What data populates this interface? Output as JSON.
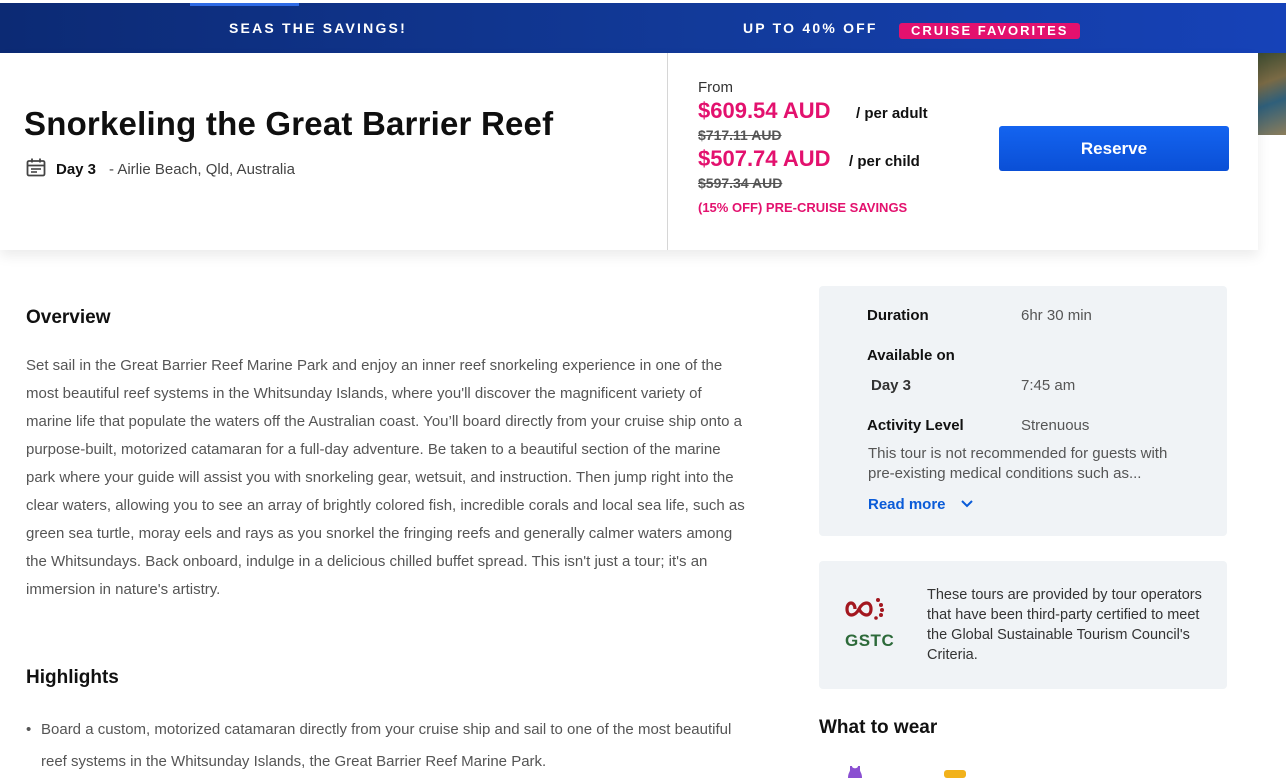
{
  "banner": {
    "left_text": "SEAS THE SAVINGS!",
    "right_text": "UP TO 40% OFF",
    "pill_text": "CRUISE FAVORITES",
    "colors": {
      "banner": "#123a9a",
      "pill": "#e3116e"
    }
  },
  "tour": {
    "title": "Snorkeling the Great Barrier Reef",
    "day": "Day 3",
    "location": "- Airlie Beach, Qld, Australia"
  },
  "pricing": {
    "from_label": "From",
    "adult_price": "$609.54 AUD",
    "adult_unit": "/ per adult",
    "adult_original": "$717.11 AUD",
    "child_price": "$507.74 AUD",
    "child_unit": "/ per child",
    "child_original": "$597.34 AUD",
    "savings_text": "(15% OFF) PRE-CRUISE SAVINGS",
    "reserve_label": "Reserve",
    "colors": {
      "sale": "#e3116e",
      "button": "#0a55e0"
    }
  },
  "overview": {
    "heading": "Overview",
    "body": "Set sail in the Great Barrier Reef Marine Park and enjoy an inner reef snorkeling experience in one of the most beautiful reef systems in the Whitsunday Islands, where you'll discover the magnificent variety of marine life that populate the waters off the Australian coast. You’ll board directly from your cruise ship onto a purpose-built, motorized catamaran for a full-day adventure. Be taken to a beautiful section of the marine park where your guide will assist you with snorkeling gear, wetsuit, and instruction. Then jump right into the clear waters, allowing you to see an array of brightly colored fish, incredible corals and local sea life, such as green sea turtle, moray eels and rays as you snorkel the fringing reefs and generally calmer waters among the Whitsundays. Back onboard, indulge in a delicious chilled buffet spread. This isn't just a tour; it's an immersion in nature's artistry."
  },
  "highlights": {
    "heading": "Highlights",
    "items": [
      "Board a custom, motorized catamaran directly from your cruise ship and sail to one of the most beautiful reef systems in the Whitsunday Islands, the Great Barrier Reef Marine Park."
    ]
  },
  "details": {
    "duration_label": "Duration",
    "duration_value": "6hr 30 min",
    "available_label": "Available on",
    "available_day": "Day 3",
    "available_time": "7:45 am",
    "activity_label": "Activity Level",
    "activity_value": "Strenuous",
    "activity_note": "This tour is not recommended for guests with pre-existing medical conditions such as...",
    "read_more": "Read more"
  },
  "gstc": {
    "logo_text": "GSTC",
    "text": "These tours are provided by tour operators that have been third-party certified to meet the Global Sustainable Tourism Council's Criteria."
  },
  "wear": {
    "heading": "What to wear"
  }
}
